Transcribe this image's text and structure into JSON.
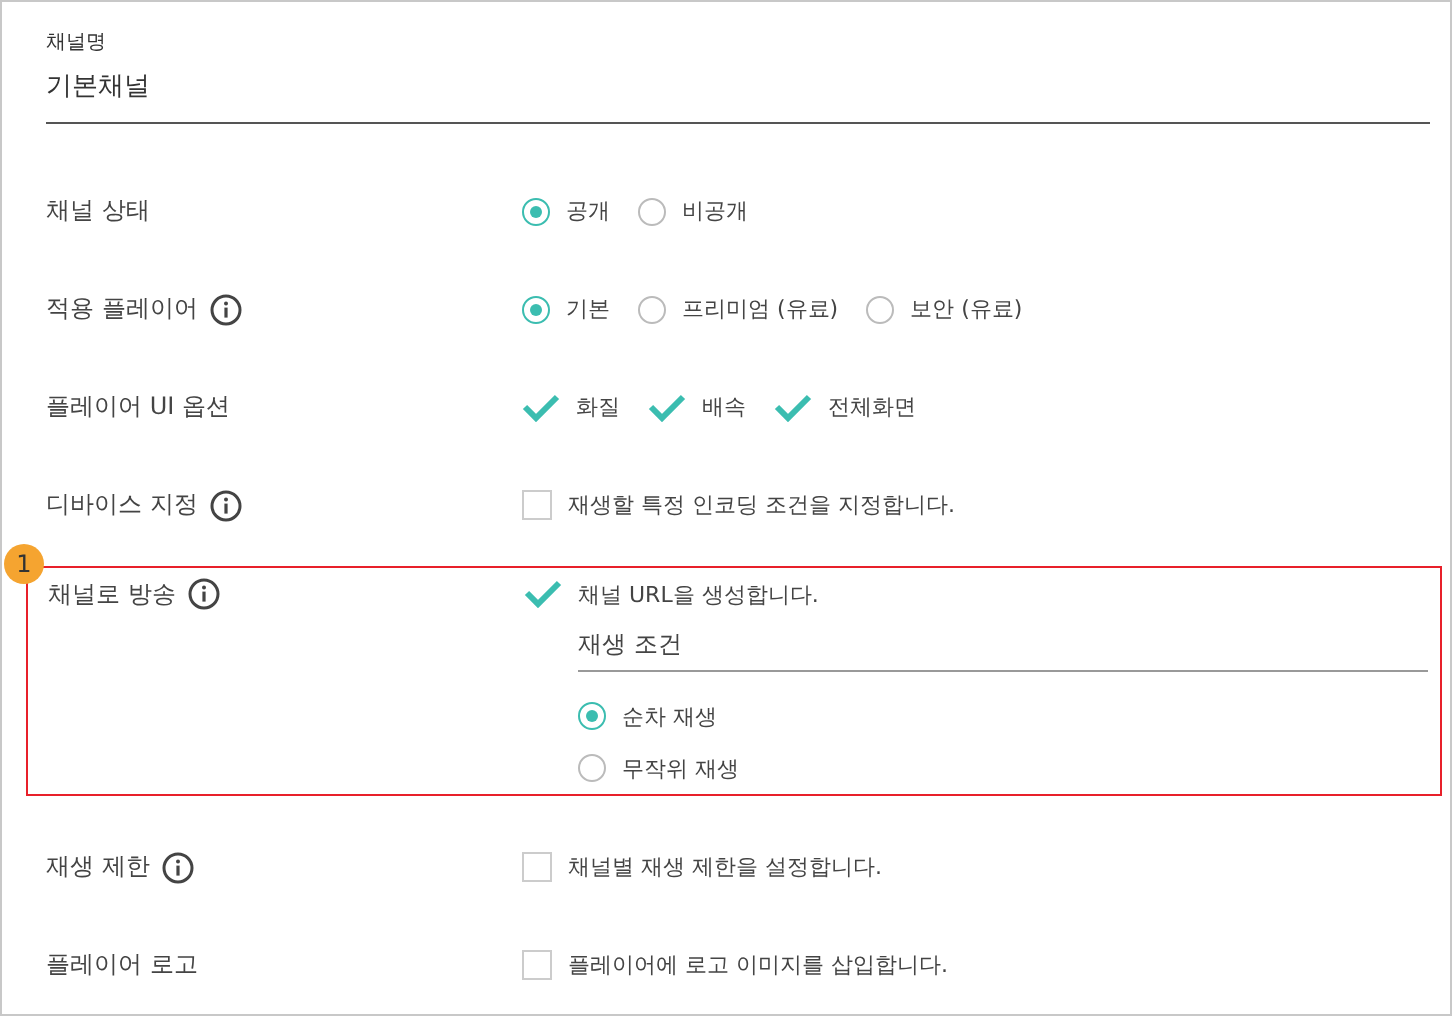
{
  "name_field": {
    "label": "채널명",
    "value": "기본채널"
  },
  "rows": [
    {
      "label": "채널 상태",
      "info": false,
      "highlight": false,
      "kind": "radio",
      "options": [
        {
          "label": "공개",
          "selected": true
        },
        {
          "label": "비공개",
          "selected": false
        }
      ]
    },
    {
      "label": "적용 플레이어",
      "info": true,
      "highlight": false,
      "kind": "radio",
      "options": [
        {
          "label": "기본",
          "selected": true
        },
        {
          "label": "프리미엄 (유료)",
          "selected": false
        },
        {
          "label": "보안 (유료)",
          "selected": false
        }
      ]
    },
    {
      "label": "플레이어 UI 옵션",
      "info": false,
      "highlight": false,
      "kind": "check",
      "options": [
        {
          "label": "화질",
          "checked": true
        },
        {
          "label": "배속",
          "checked": true
        },
        {
          "label": "전체화면",
          "checked": true
        }
      ]
    },
    {
      "label": "디바이스 지정",
      "info": true,
      "highlight": false,
      "kind": "check",
      "options": [
        {
          "label": "재생할 특정 인코딩 조건을 지정합니다.",
          "checked": false
        }
      ]
    },
    {
      "label": "채널로 방송",
      "info": true,
      "kind": "broadcast",
      "highlight": true,
      "badge": "1",
      "options": [
        {
          "label": "채널 URL을 생성합니다.",
          "checked": true
        }
      ],
      "sub_field": {
        "value": "재생 조건"
      },
      "sub_options": [
        {
          "label": "순차 재생",
          "selected": true
        },
        {
          "label": "무작위 재생",
          "selected": false
        }
      ]
    },
    {
      "label": "재생 제한",
      "info": true,
      "highlight": false,
      "kind": "check",
      "options": [
        {
          "label": "채널별 재생 제한을 설정합니다.",
          "checked": false
        }
      ]
    },
    {
      "label": "플레이어 로고",
      "info": false,
      "highlight": false,
      "kind": "check",
      "options": [
        {
          "label": "플레이어에 로고 이미지를 삽입합니다.",
          "checked": false
        }
      ]
    }
  ]
}
